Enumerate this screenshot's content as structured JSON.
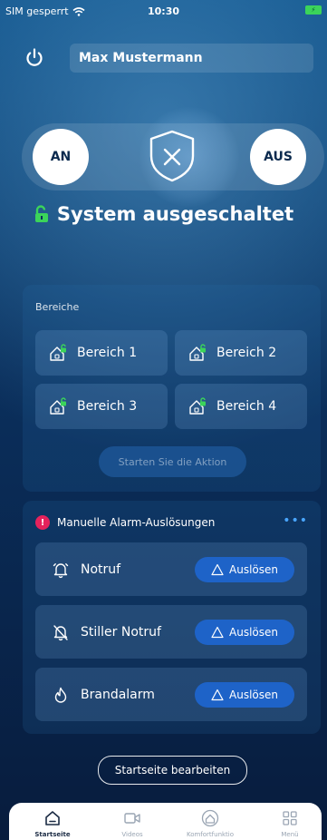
{
  "status_bar": {
    "carrier": "SIM gesperrt",
    "time": "10:30"
  },
  "header": {
    "user_name": "Max Mustermann"
  },
  "arm_control": {
    "on_label": "AN",
    "off_label": "AUS"
  },
  "system_status": {
    "text": "System ausgeschaltet",
    "lock_color": "#3bd45a"
  },
  "areas": {
    "title": "Bereiche",
    "items": [
      "Bereich 1",
      "Bereich 2",
      "Bereich 3",
      "Bereich 4"
    ],
    "action_label": "Starten Sie die Aktion"
  },
  "manual_alarms": {
    "title": "Manuelle Alarm-Auslösungen",
    "more_label": "•••",
    "items": [
      {
        "label": "Notruf",
        "icon": "bell-icon",
        "button": "Auslösen"
      },
      {
        "label": "Stiller Notruf",
        "icon": "bell-off-icon",
        "button": "Auslösen"
      },
      {
        "label": "Brandalarm",
        "icon": "flame-icon",
        "button": "Auslösen"
      }
    ]
  },
  "edit_button": "Startseite bearbeiten",
  "tabs": [
    "Startseite",
    "Videos",
    "Komfortfunktio",
    "Menü"
  ],
  "colors": {
    "accent": "#1e63c8",
    "alert": "#e5225c",
    "active_tab": "#1b2b44"
  }
}
